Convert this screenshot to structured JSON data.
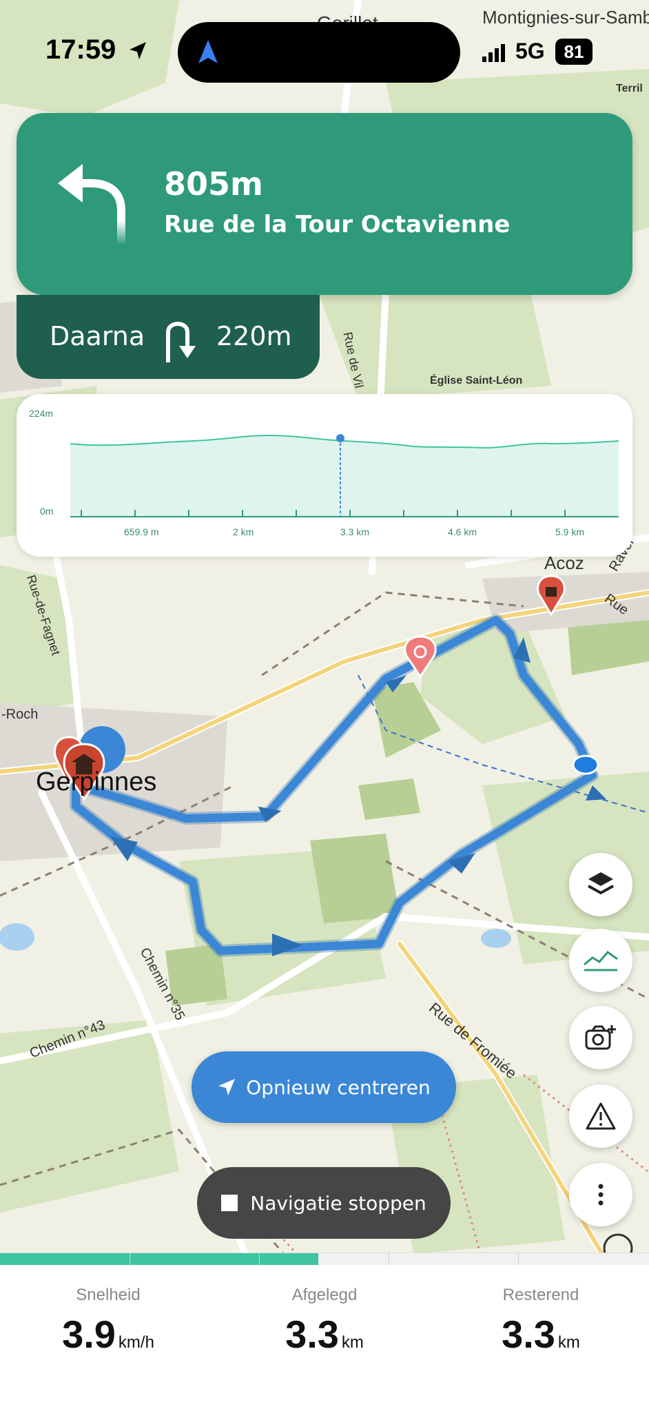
{
  "status_bar": {
    "time": "17:59",
    "network": "5G",
    "battery": "81"
  },
  "map_labels": {
    "top_center": "Gerillet",
    "top_right": "Montignies-sur-Sambre",
    "terril": "Terril",
    "eglise": "Église Saint-Léon",
    "rue_de_vil": "Rue de Vil",
    "acoz": "Acoz",
    "ravel": "Ravel",
    "rue_de_fagnet": "Rue-de-Fagnet",
    "roch": "-Roch",
    "gerpinnes": "Gerpinnes",
    "chemin_43": "Chemin n°43",
    "chemin_35": "Chemin n°35",
    "rue_de_fromiee": "Rue de Fromiée",
    "rue_e": "Rue"
  },
  "navigation": {
    "distance": "805m",
    "street": "Rue de la Tour Octavienne"
  },
  "next_maneuver": {
    "label": "Daarna",
    "distance": "220m"
  },
  "elevation": {
    "max_label": "224m",
    "min_label": "0m",
    "x_labels": [
      "659.9 m",
      "2 km",
      "3.3 km",
      "4.6 km",
      "5.9 km"
    ]
  },
  "buttons": {
    "recenter": "Opnieuw centreren",
    "stop": "Navigatie stoppen"
  },
  "progress": {
    "fraction": 0.49
  },
  "stats": [
    {
      "label": "Snelheid",
      "value": "3.9",
      "unit": "km/h"
    },
    {
      "label": "Afgelegd",
      "value": "3.3",
      "unit": "km"
    },
    {
      "label": "Resterend",
      "value": "3.3",
      "unit": "km"
    }
  ],
  "colors": {
    "accent_green": "#2e9a7a",
    "route_blue": "#3b87d6",
    "poi_red": "#d9503f"
  }
}
